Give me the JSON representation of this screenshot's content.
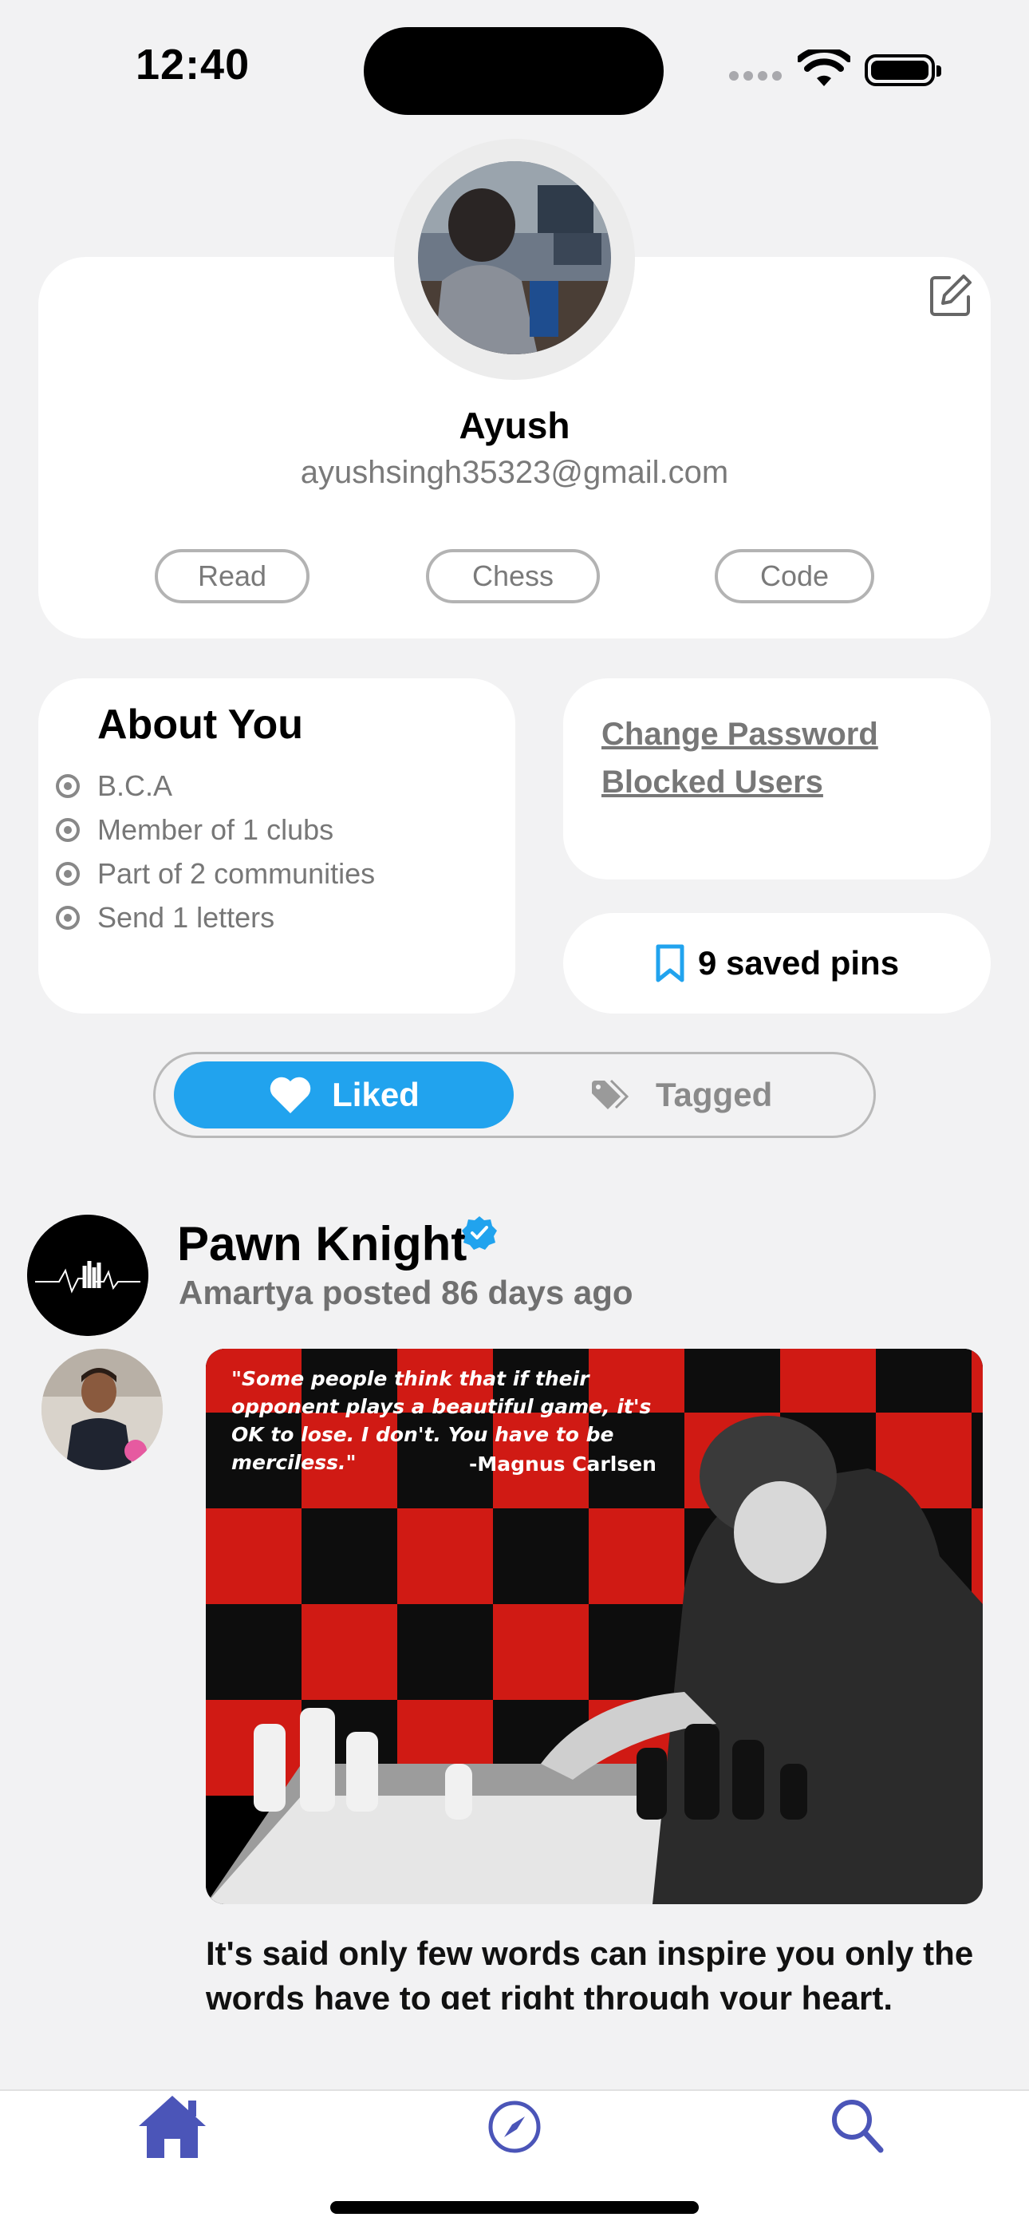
{
  "status_bar": {
    "time": "12:40"
  },
  "profile": {
    "name": "Ayush",
    "email": "ayushsingh35323@gmail.com",
    "interests": [
      "Read",
      "Chess",
      "Code"
    ]
  },
  "about": {
    "title": "About You",
    "items": [
      "B.C.A",
      "Member of 1 clubs",
      "Part of 2 communities",
      "Send 1 letters"
    ]
  },
  "settings": {
    "change_password": "Change Password",
    "blocked_users": "Blocked Users"
  },
  "saved_pins": {
    "label": "9 saved pins"
  },
  "segment": {
    "liked": "Liked",
    "tagged": "Tagged",
    "active": "Liked"
  },
  "post": {
    "club_name": "Pawn Knight",
    "meta": "Amartya posted 86 days ago",
    "verified": true,
    "image_quote": "\"Some people think that if their opponent plays a beautiful game, it's OK to lose. I don't. You have to be merciless.\"",
    "image_author": "-Magnus Carlsen",
    "text": "It's said only few words can inspire you only the words have to get right through your heart."
  },
  "tabbar": {
    "items": [
      "home-icon",
      "compass-icon",
      "search-icon"
    ]
  },
  "colors": {
    "accent": "#21a3ee",
    "tab_icon": "#4b55b8",
    "background": "#f2f2f3"
  }
}
